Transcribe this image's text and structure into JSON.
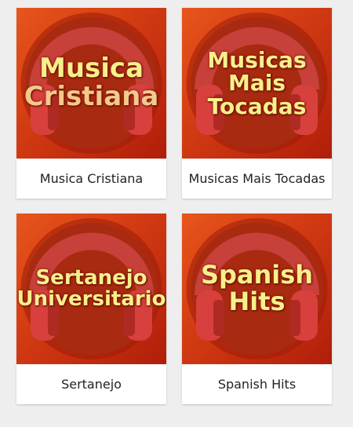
{
  "cards": [
    {
      "caption": "Musica Cristiana",
      "art_lines": [
        "Musica",
        "Cristiana"
      ],
      "icon": "headphones-icon"
    },
    {
      "caption": "Musicas Mais Tocadas",
      "art_lines": [
        "Musicas",
        "Mais",
        "Tocadas"
      ],
      "icon": "headphones-icon"
    },
    {
      "caption": "Sertanejo",
      "art_lines": [
        "Sertanejo",
        "Universitario"
      ],
      "icon": "headphones-icon"
    },
    {
      "caption": "Spanish Hits",
      "art_lines": [
        "Spanish",
        "Hits"
      ],
      "icon": "headphones-icon"
    }
  ],
  "colors": {
    "background": "#eeeeee",
    "art_orange": "#e8551c",
    "art_red": "#b01e0a",
    "headphone_red": "#d8403e",
    "art_text": "#f7f08a"
  }
}
